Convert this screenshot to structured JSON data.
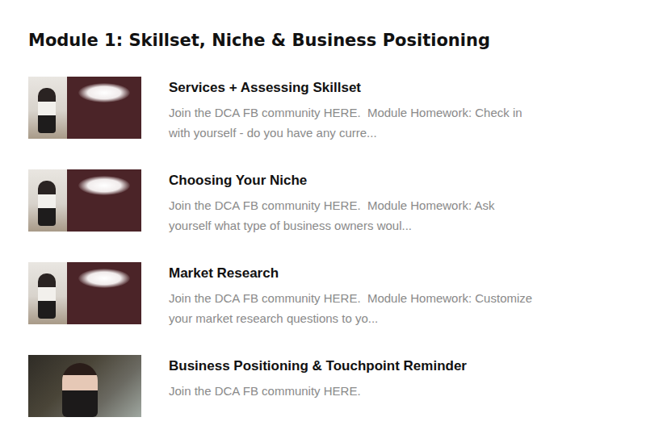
{
  "module": {
    "title": "Module 1: Skillset, Niche & Business Positioning"
  },
  "lessons": [
    {
      "title": "Services + Assessing Skillset",
      "description": "Join the DCA FB community HERE.  Module Homework: Check in with yourself - do you have any curre...",
      "kind": "slide"
    },
    {
      "title": "Choosing Your Niche",
      "description": "Join the DCA FB community HERE.  Module Homework: Ask yourself what type of business owners woul...",
      "kind": "slide"
    },
    {
      "title": "Market Research",
      "description": "Join the DCA FB community HERE.  Module Homework: Customize your market research questions to yo...",
      "kind": "slide"
    },
    {
      "title": "Business Positioning & Touchpoint Reminder",
      "description": "Join the DCA FB community HERE.",
      "kind": "photo"
    }
  ]
}
